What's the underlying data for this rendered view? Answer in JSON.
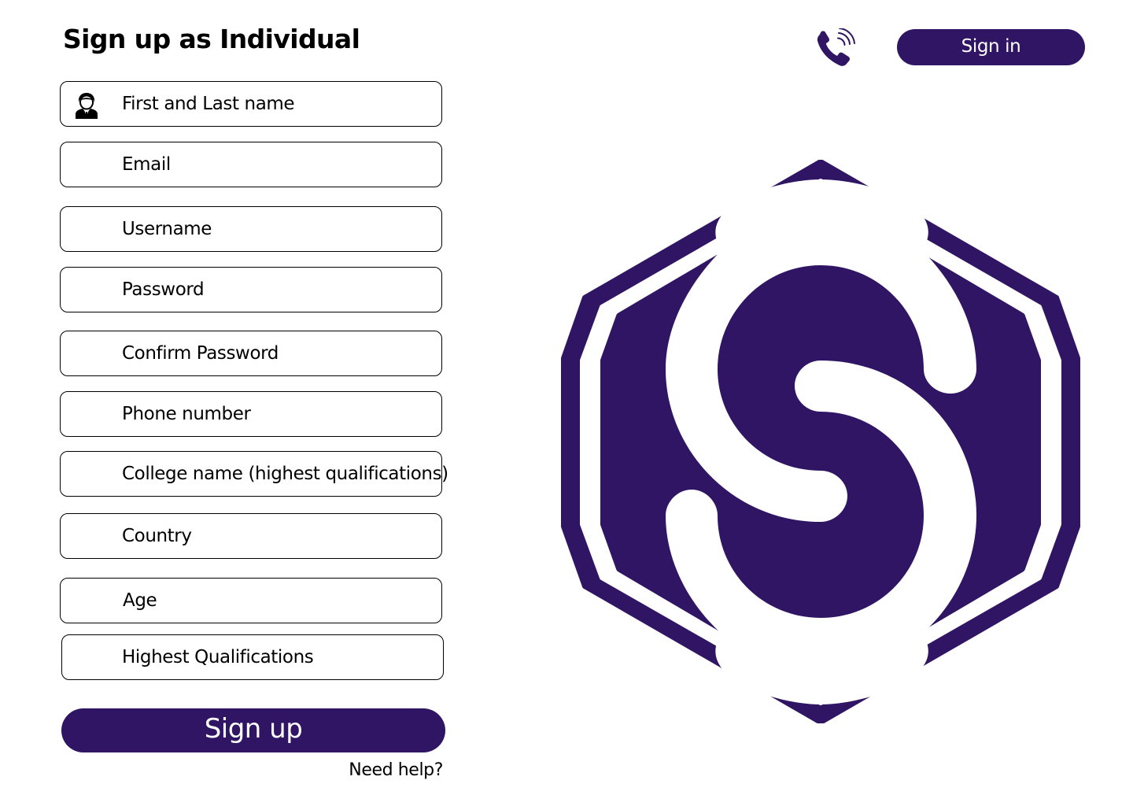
{
  "header": {
    "title": "Sign up as Individual",
    "signin_label": "Sign in"
  },
  "form": {
    "fields": [
      "First and Last name",
      "Email",
      "Username",
      "Password",
      "Confirm Password",
      "Phone number",
      "College name (highest qualifications)",
      "Country",
      "Age",
      "Highest Qualifications"
    ],
    "signup_label": "Sign up",
    "help_label": "Need help?"
  },
  "icons": {
    "field_icon": "person-icon",
    "contact_icon": "phone-icon",
    "logo": "hexagon-s-logo"
  },
  "colors": {
    "brand": "#2f1563",
    "background": "#ffffff",
    "text": "#000000",
    "border": "#000000"
  }
}
